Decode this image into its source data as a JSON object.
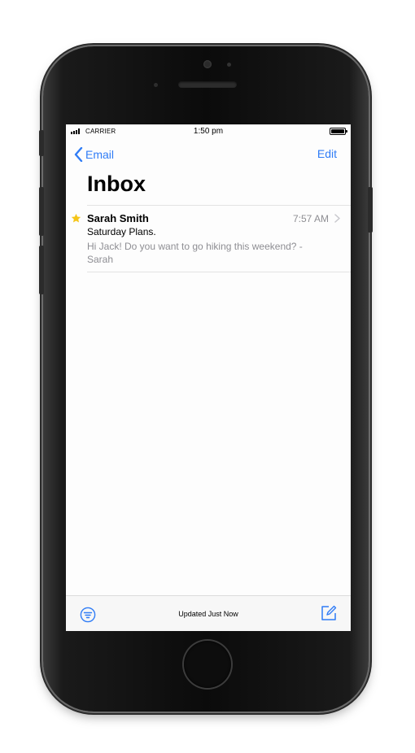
{
  "status_bar": {
    "carrier": "CARRIER",
    "time": "1:50 pm"
  },
  "nav": {
    "back_label": "Email",
    "edit_label": "Edit"
  },
  "title": "Inbox",
  "messages": [
    {
      "sender": "Sarah Smith",
      "time": "7:57 AM",
      "subject": "Saturday Plans.",
      "preview": "Hi Jack! Do you want to go hiking this weekend? -Sarah",
      "starred": true
    }
  ],
  "toolbar": {
    "status_text": "Updated Just Now"
  },
  "colors": {
    "accent": "#2f7cf6",
    "star": "#f5c518",
    "secondary_text": "#8e8e93"
  },
  "icons": {
    "back": "chevron-left-icon",
    "star": "star-icon",
    "disclosure": "chevron-right-icon",
    "filter": "filter-icon",
    "compose": "compose-icon"
  }
}
